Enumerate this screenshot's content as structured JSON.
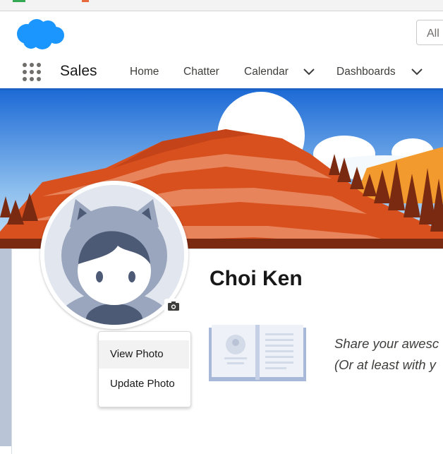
{
  "header": {
    "search_placeholder": "All"
  },
  "nav": {
    "app_name": "Sales",
    "items": [
      {
        "label": "Home"
      },
      {
        "label": "Chatter"
      },
      {
        "label": "Calendar"
      },
      {
        "label": "Dashboards"
      }
    ]
  },
  "profile": {
    "name": "Choi Ken",
    "photo_menu": {
      "items": [
        "View Photo",
        "Update Photo"
      ]
    },
    "share_text_line1": "Share your awesc",
    "share_text_line2": "(Or at least with y"
  },
  "colors": {
    "brand_blue": "#1b96ff",
    "nav_accent": "#1b62c4"
  },
  "icons": [
    "salesforce-cloud-icon",
    "app-launcher-icon",
    "chevron-down-icon",
    "camera-icon"
  ]
}
